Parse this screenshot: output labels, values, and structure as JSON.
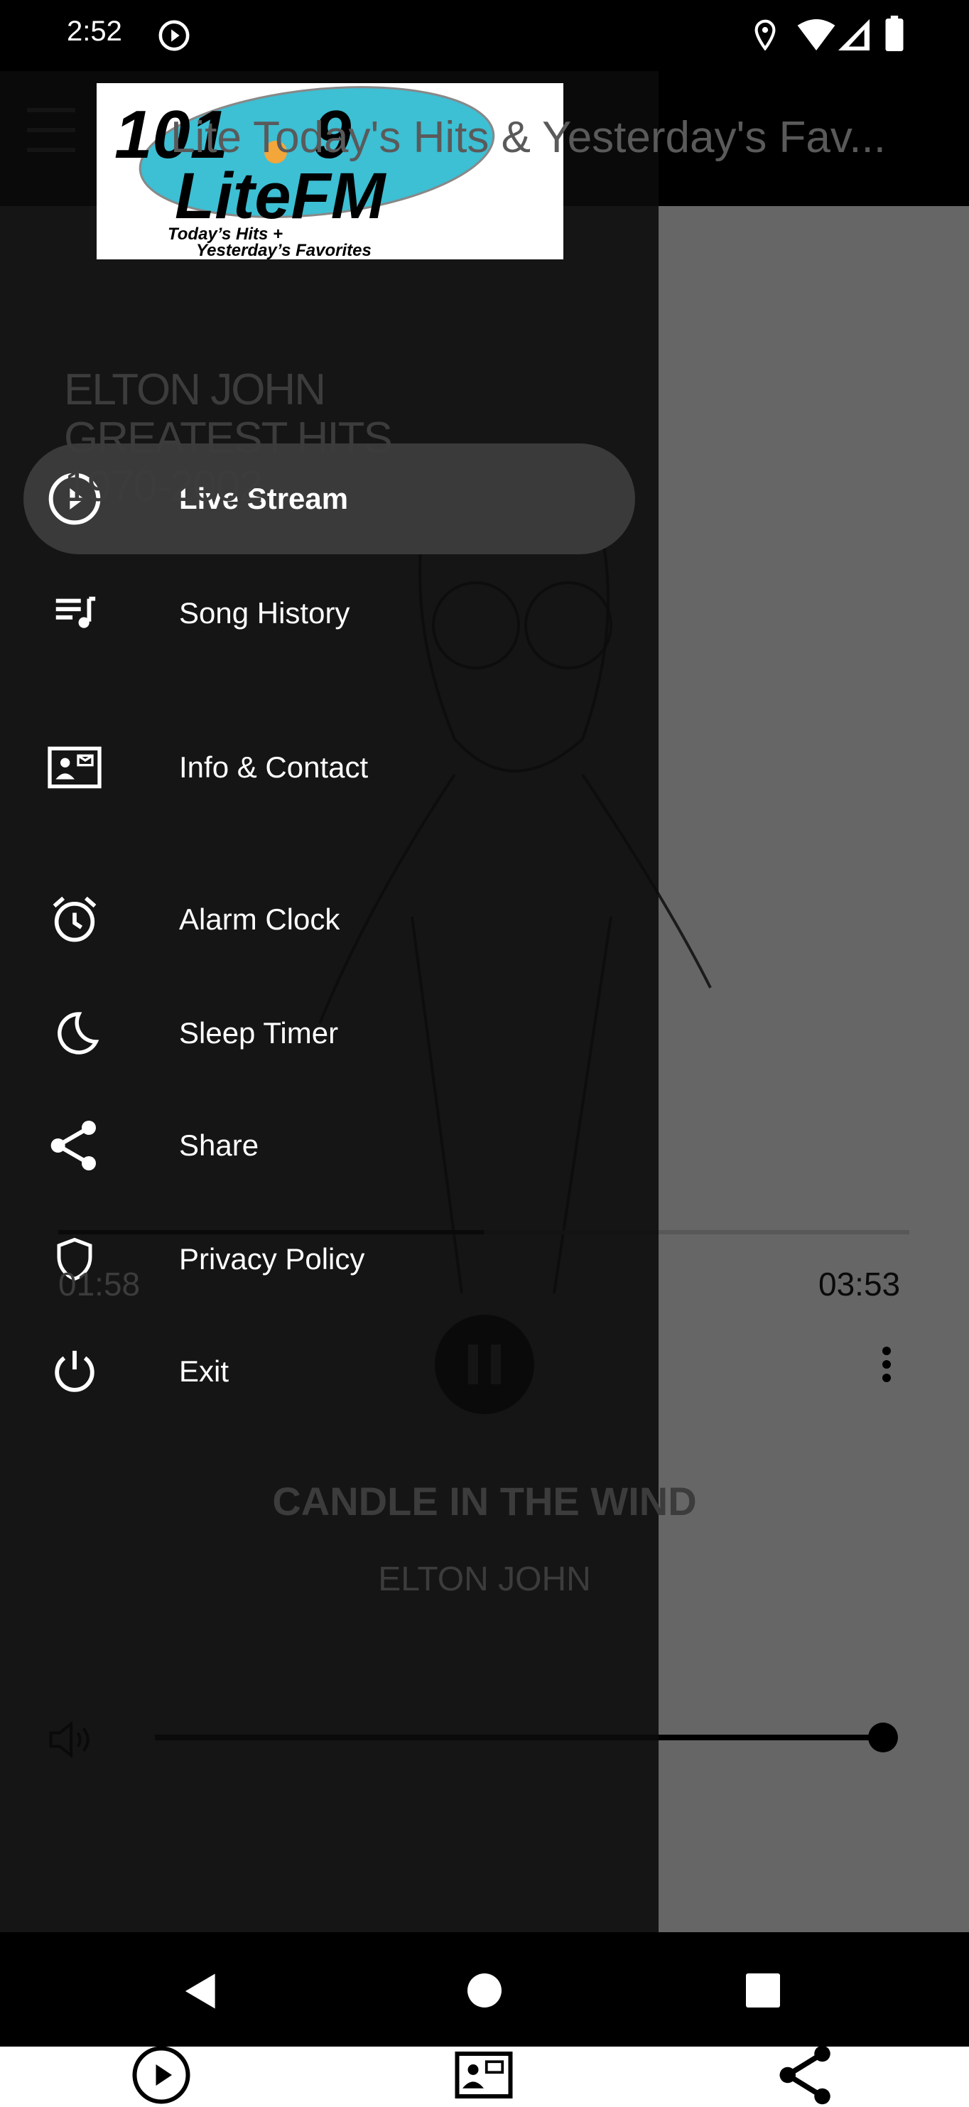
{
  "status_bar": {
    "time": "2:52",
    "icons": [
      "media-play-icon",
      "location-icon",
      "wifi-icon",
      "signal-icon",
      "battery-icon"
    ]
  },
  "app_bar": {
    "title": "Lite Today's Hits & Yesterday's Fav...",
    "menu_icon": "hamburger-icon"
  },
  "logo": {
    "main": "101.9 LiteFM",
    "tagline_1": "Today's Hits +",
    "tagline_2": "Yesterday's Favorites",
    "colors": {
      "ellipse": "#3dbfd4",
      "sun": "#f3a63a"
    }
  },
  "drawer": {
    "items": [
      {
        "label": "Live Stream",
        "icon": "play-circle-icon",
        "active": true
      },
      {
        "label": "Song History",
        "icon": "playlist-icon"
      },
      {
        "label": "Info & Contact",
        "icon": "contact-card-icon"
      },
      {
        "label": "Alarm Clock",
        "icon": "alarm-clock-icon"
      },
      {
        "label": "Sleep Timer",
        "icon": "moon-icon"
      },
      {
        "label": "Share",
        "icon": "share-icon"
      },
      {
        "label": "Privacy Policy",
        "icon": "shield-icon"
      },
      {
        "label": "Exit",
        "icon": "power-icon"
      }
    ],
    "active_bg": "#3a3a3a"
  },
  "player": {
    "album_text": [
      "ELTON JOHN",
      "GREATEST HITS",
      "1970-2002"
    ],
    "elapsed": "01:58",
    "duration": "03:53",
    "progress": 0.5,
    "song_title": "CANDLE IN THE WIND",
    "artist": "ELTON JOHN",
    "volume": 1.0
  },
  "bottom_bar": {
    "icons": [
      "play-circle-icon",
      "contact-card-icon",
      "share-icon"
    ]
  }
}
